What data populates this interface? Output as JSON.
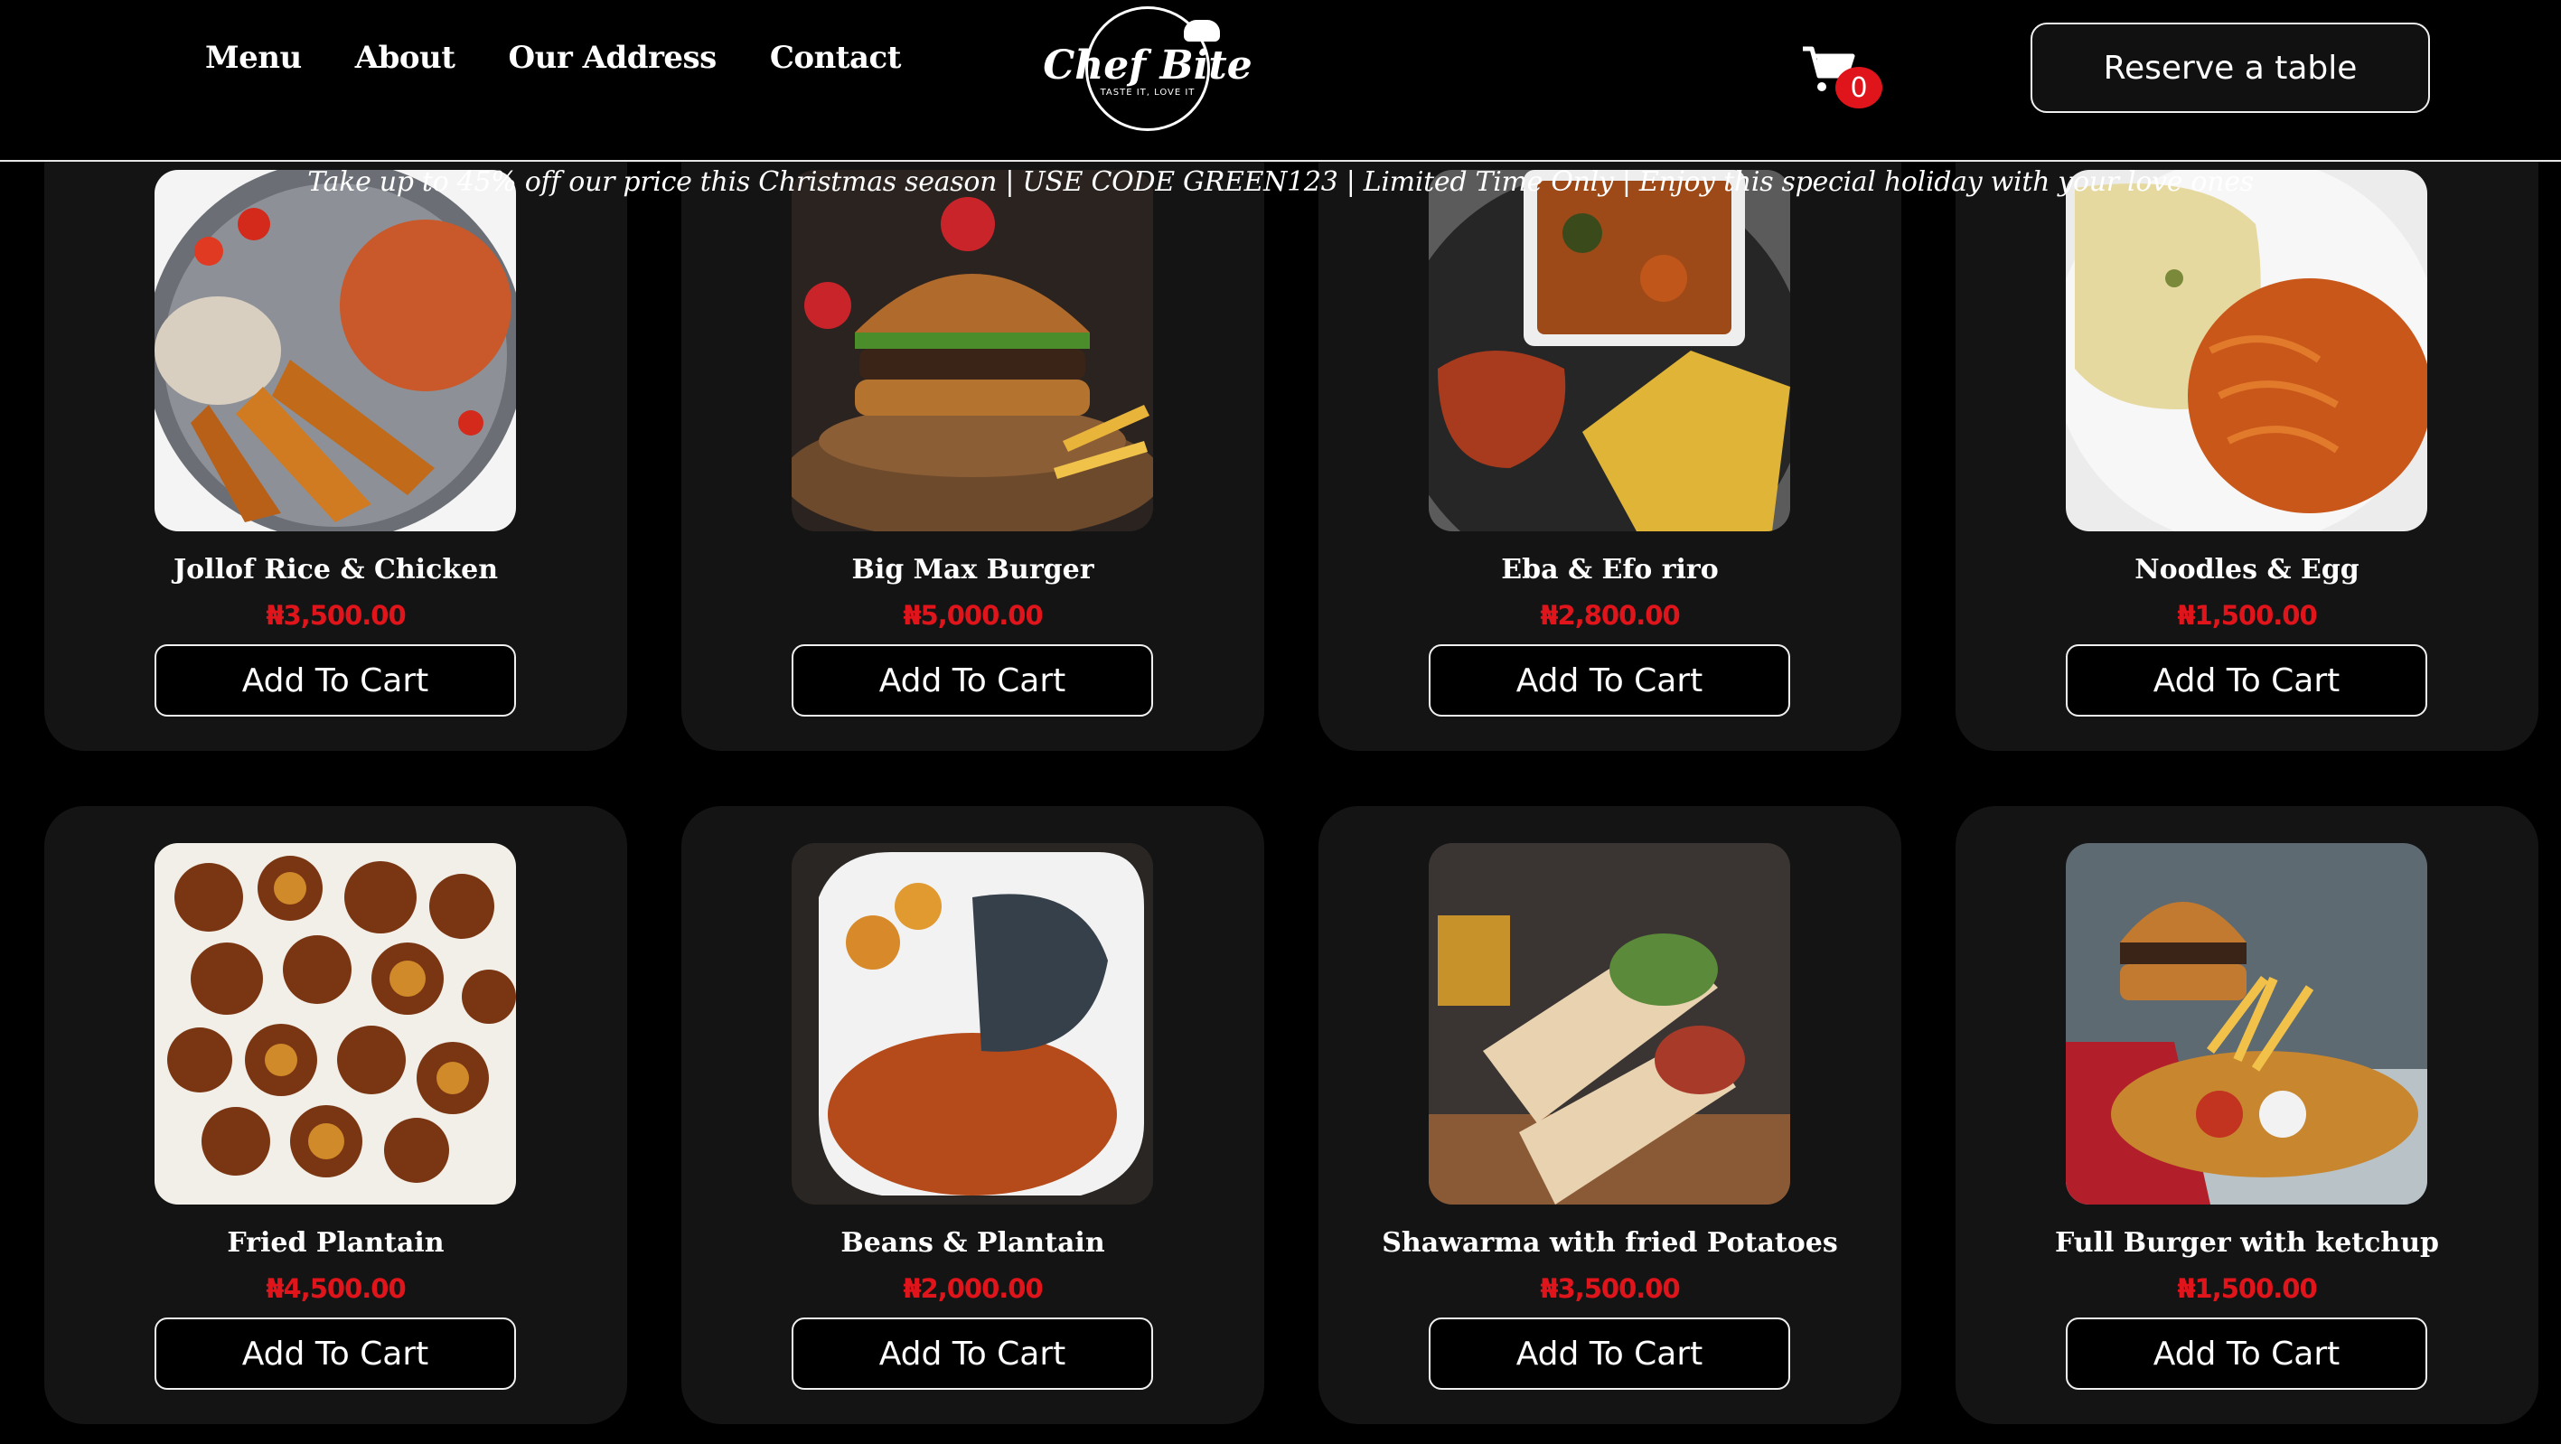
{
  "nav": {
    "items": [
      "Menu",
      "About",
      "Our Address",
      "Contact"
    ]
  },
  "logo": {
    "text": "Chef Bite",
    "tagline": "TASTE IT, LOVE IT"
  },
  "cart": {
    "icon": "cart-icon",
    "count": "0"
  },
  "reserve_label": "Reserve a table",
  "promo": "Take up to 45% off our price this Christmas season | USE CODE GREEN123 | Limited Time Only | Enjoy this special holiday with your love ones",
  "products": [
    {
      "name": "Jollof Rice & Chicken",
      "price": "₦3,500.00",
      "button": "Add To Cart"
    },
    {
      "name": "Big Max Burger",
      "price": "₦5,000.00",
      "button": "Add To Cart"
    },
    {
      "name": "Eba & Efo riro",
      "price": "₦2,800.00",
      "button": "Add To Cart"
    },
    {
      "name": "Noodles & Egg",
      "price": "₦1,500.00",
      "button": "Add To Cart"
    },
    {
      "name": "Fried Plantain",
      "price": "₦4,500.00",
      "button": "Add To Cart"
    },
    {
      "name": "Beans & Plantain",
      "price": "₦2,000.00",
      "button": "Add To Cart"
    },
    {
      "name": "Shawarma with fried Potatoes",
      "price": "₦3,500.00",
      "button": "Add To Cart"
    },
    {
      "name": "Full Burger with ketchup",
      "price": "₦1,500.00",
      "button": "Add To Cart"
    }
  ],
  "colors": {
    "accent_red": "#e0141b",
    "card_bg": "#141414",
    "page_bg": "#000000"
  }
}
